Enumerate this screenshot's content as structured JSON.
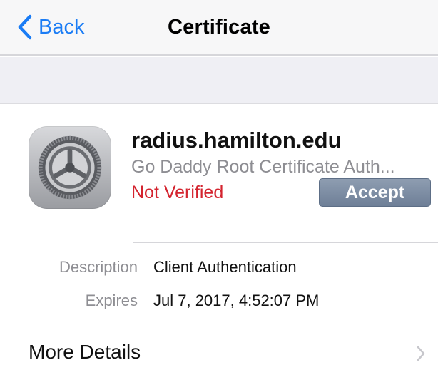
{
  "navbar": {
    "back_label": "Back",
    "title": "Certificate"
  },
  "certificate": {
    "name": "radius.hamilton.edu",
    "issuer": "Go Daddy Root Certificate Auth...",
    "status": "Not Verified",
    "accept_label": "Accept",
    "icon": "settings-gear-icon"
  },
  "details": [
    {
      "key": "Description",
      "value": "Client Authentication"
    },
    {
      "key": "Expires",
      "value": "Jul 7, 2017, 4:52:07 PM"
    }
  ],
  "more_details": {
    "label": "More Details",
    "icon": "chevron-right-icon"
  },
  "colors": {
    "accent": "#1a7cf5",
    "status_error": "#d4242f",
    "secondary_text": "#8e8e93",
    "accept_button": "#7a8aa2"
  }
}
